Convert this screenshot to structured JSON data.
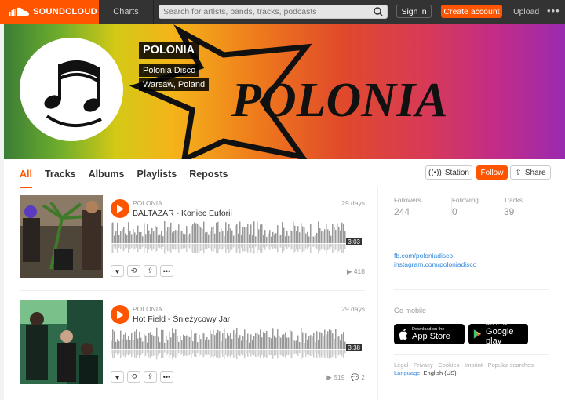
{
  "topbar": {
    "logo_text": "SOUNDCLOUD",
    "charts": "Charts",
    "search_placeholder": "Search for artists, bands, tracks, podcasts",
    "sign_in": "Sign in",
    "create_account": "Create account",
    "upload": "Upload",
    "more": "•••"
  },
  "profile": {
    "name": "POLONIA",
    "full_name": "Polonia Disco",
    "location": "Warsaw, Poland",
    "banner_text": "POLONIA"
  },
  "tabs": [
    "All",
    "Tracks",
    "Albums",
    "Playlists",
    "Reposts"
  ],
  "actions": {
    "station": "Station",
    "follow": "Follow",
    "share": "Share"
  },
  "tracks": [
    {
      "artist": "POLONIA",
      "title": "BALTAZAR - Koniec Euforii",
      "date": "29 days",
      "duration": "3:03",
      "plays": "418",
      "comments": ""
    },
    {
      "artist": "POLONIA",
      "title": "Hot Field - Śnieżycowy Jar",
      "date": "29 days",
      "duration": "3:38",
      "plays": "519",
      "comments": "2"
    }
  ],
  "stats": [
    {
      "label": "Followers",
      "value": "244"
    },
    {
      "label": "Following",
      "value": "0"
    },
    {
      "label": "Tracks",
      "value": "39"
    }
  ],
  "links": [
    "fb.com/poloniadisco",
    "instagram.com/poloniadisco"
  ],
  "go_mobile": "Go mobile",
  "app_store": {
    "small": "Download on the",
    "big": "App Store"
  },
  "google_play": {
    "small": "GET IT ON",
    "big": "Google play"
  },
  "legal": {
    "line": "Legal - Privacy - Cookies - Imprint - Popular searches",
    "language_label": "Language:",
    "language_value": "English (US)"
  },
  "colors": {
    "accent": "#ff5500",
    "topbar": "#333333",
    "link": "#3388dd"
  }
}
